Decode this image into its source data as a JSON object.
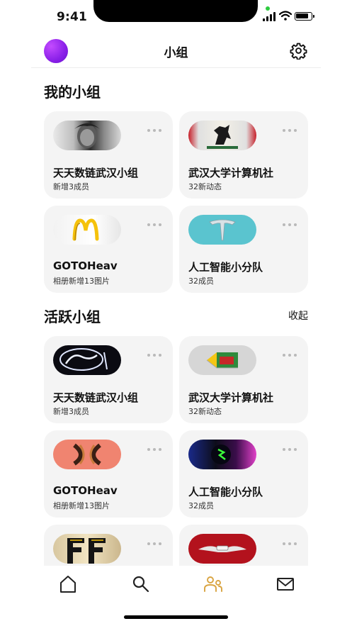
{
  "status": {
    "time": "9:41"
  },
  "nav": {
    "title": "小组"
  },
  "sections": {
    "mine": {
      "title": "我的小组"
    },
    "active": {
      "title": "活跃小组",
      "action": "收起"
    }
  },
  "my_groups": [
    {
      "name": "天天数链武汉小组",
      "sub": "新增3成员"
    },
    {
      "name": "武汉大学计算机社",
      "sub": "32新动态"
    },
    {
      "name": "GOTOHeav",
      "sub": "相册新增13图片"
    },
    {
      "name": "人工智能小分队",
      "sub": "32成员"
    }
  ],
  "active_groups": [
    {
      "name": "天天数链武汉小组",
      "sub": "新增3成员"
    },
    {
      "name": "武汉大学计算机社",
      "sub": "32新动态"
    },
    {
      "name": "GOTOHeav",
      "sub": "相册新增13图片"
    },
    {
      "name": "人工智能小分队",
      "sub": "32成员"
    },
    {
      "name": "",
      "sub": ""
    },
    {
      "name": "",
      "sub": ""
    }
  ],
  "tabs": [
    "home-icon",
    "search-icon",
    "groups-icon",
    "mail-icon"
  ],
  "colors": {
    "accent": "#d9a441",
    "card_bg": "#f4f4f4",
    "avatar": "#8a20e8"
  }
}
